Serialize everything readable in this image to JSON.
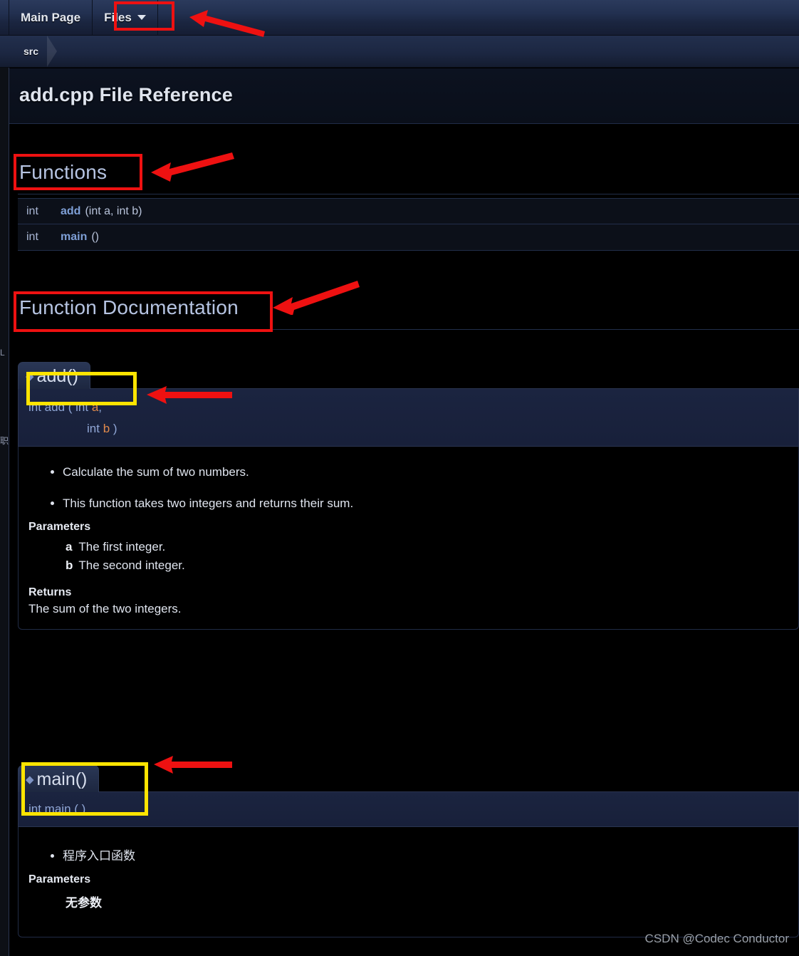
{
  "nav": {
    "tabs": [
      {
        "label": "Main Page",
        "has_caret": false
      },
      {
        "label": "Files",
        "has_caret": true,
        "caret_icon": "chevron-down-icon"
      }
    ]
  },
  "breadcrumb": {
    "items": [
      "src"
    ]
  },
  "page_title": "add.cpp File Reference",
  "sections": [
    {
      "id": "functions",
      "heading": "Functions"
    },
    {
      "id": "function-documentation",
      "heading": "Function Documentation"
    }
  ],
  "functions_table": {
    "rows": [
      {
        "type": "int",
        "name": "add",
        "args": "(int a, int b)"
      },
      {
        "type": "int",
        "name": "main",
        "args": "()"
      }
    ]
  },
  "members": [
    {
      "title": "add()",
      "bullet_icon": "diamond-bullet-icon",
      "proto": {
        "line1_pre": "int add ( int ",
        "line1_param": "a",
        "line1_post": ",",
        "line2_pre": "int ",
        "line2_param": "b",
        "line2_post": " )"
      },
      "description": [
        "Calculate the sum of two numbers.",
        "This function takes two integers and returns their sum."
      ],
      "parameters_label": "Parameters",
      "parameters": [
        {
          "name": "a",
          "desc": "The first integer."
        },
        {
          "name": "b",
          "desc": "The second integer."
        }
      ],
      "returns_label": "Returns",
      "returns": "The sum of the two integers."
    },
    {
      "title": "main()",
      "bullet_icon": "diamond-bullet-icon",
      "proto": {
        "line1_pre": "int main ( ",
        "line1_param": "",
        "line1_post": " )",
        "line2_pre": "",
        "line2_param": "",
        "line2_post": ""
      },
      "description": [
        "程序入口函数"
      ],
      "parameters_label": "Parameters",
      "parameters": [
        {
          "name": "无参数",
          "desc": ""
        }
      ],
      "returns_label": "",
      "returns": ""
    }
  ],
  "side_ghost_text": {
    "line1": "L",
    "line2": "职"
  },
  "watermark": "CSDN @Codec Conductor",
  "colors": {
    "annotation_red": "#ee1111",
    "annotation_yellow": "#ffe400",
    "link_blue": "#7e9fd6",
    "param_orange": "#e08a4c",
    "heading_blue": "#b6c4e2"
  }
}
